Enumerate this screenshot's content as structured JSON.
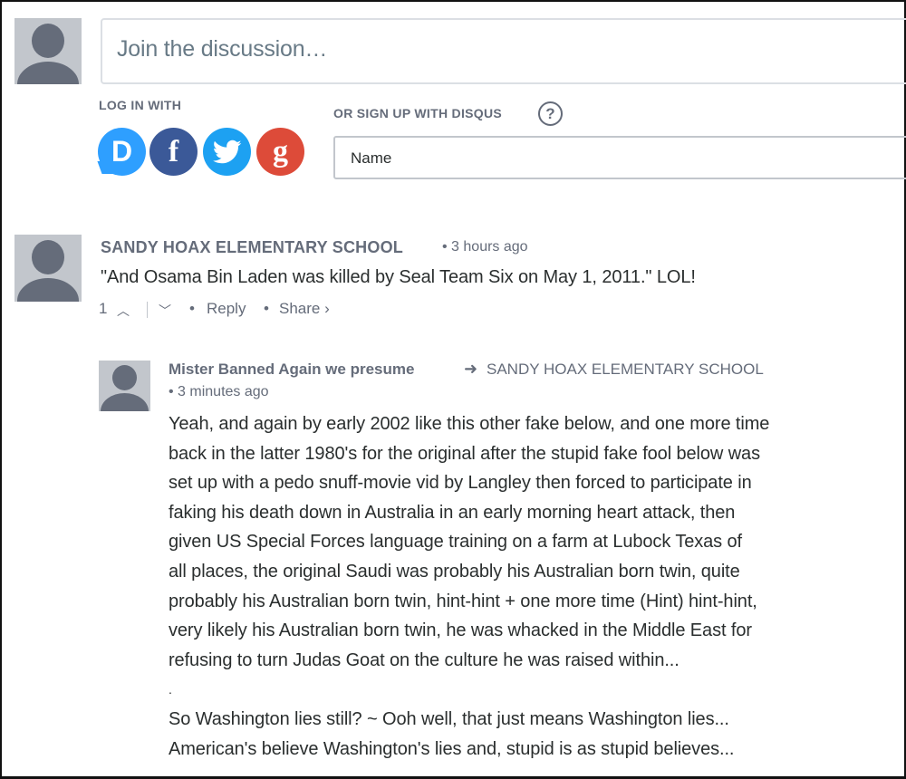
{
  "composer": {
    "placeholder": "Join the discussion…",
    "login_label": "LOG IN WITH",
    "signup_label": "OR SIGN UP WITH DISQUS",
    "help_glyph": "?",
    "name_placeholder": "Name",
    "social": [
      {
        "name": "disqus",
        "glyph": "D",
        "color": "#2e9fff"
      },
      {
        "name": "facebook",
        "glyph": "f",
        "color": "#3b5998"
      },
      {
        "name": "twitter",
        "glyph": "twitter-bird",
        "color": "#1da1f2"
      },
      {
        "name": "google",
        "glyph": "g",
        "color": "#dd4b39"
      }
    ]
  },
  "comments": [
    {
      "author": "SANDY HOAX ELEMENTARY SCHOOL",
      "time": "• 3 hours ago",
      "text": "\"And Osama Bin Laden was killed by Seal Team Six on May 1, 2011.\" LOL!",
      "votes": "1",
      "upvote_glyph": "︿",
      "downvote_glyph": "﹀",
      "dot": "•",
      "reply_label": "Reply",
      "share_label": "Share ›"
    },
    {
      "author": "Mister Banned Again we presume",
      "arrow": "➜",
      "parent": "SANDY HOAX ELEMENTARY SCHOOL",
      "time": "• 3 minutes ago",
      "lines": [
        "Yeah, and again by early 2002 like this other fake below, and one more time",
        "back in the latter 1980's for the original after the stupid fake fool below was",
        "set up with a pedo snuff-movie vid by Langley then forced to participate in",
        "faking his death down in Australia in an early morning heart attack, then",
        "given US Special Forces language training on a farm at Lubock Texas of",
        "all places, the original Saudi was probably his Australian born twin, quite",
        "probably his Australian born twin, hint-hint + one more time (Hint) hint-hint,",
        "very likely his Australian born twin, he was whacked in the Middle East for",
        "refusing to turn Judas Goat on the culture he was raised within...",
        ".",
        "So Washington lies still? ~ Ooh well, that just means Washington lies...",
        "American's believe Washington's lies and, stupid is as stupid believes..."
      ]
    }
  ]
}
